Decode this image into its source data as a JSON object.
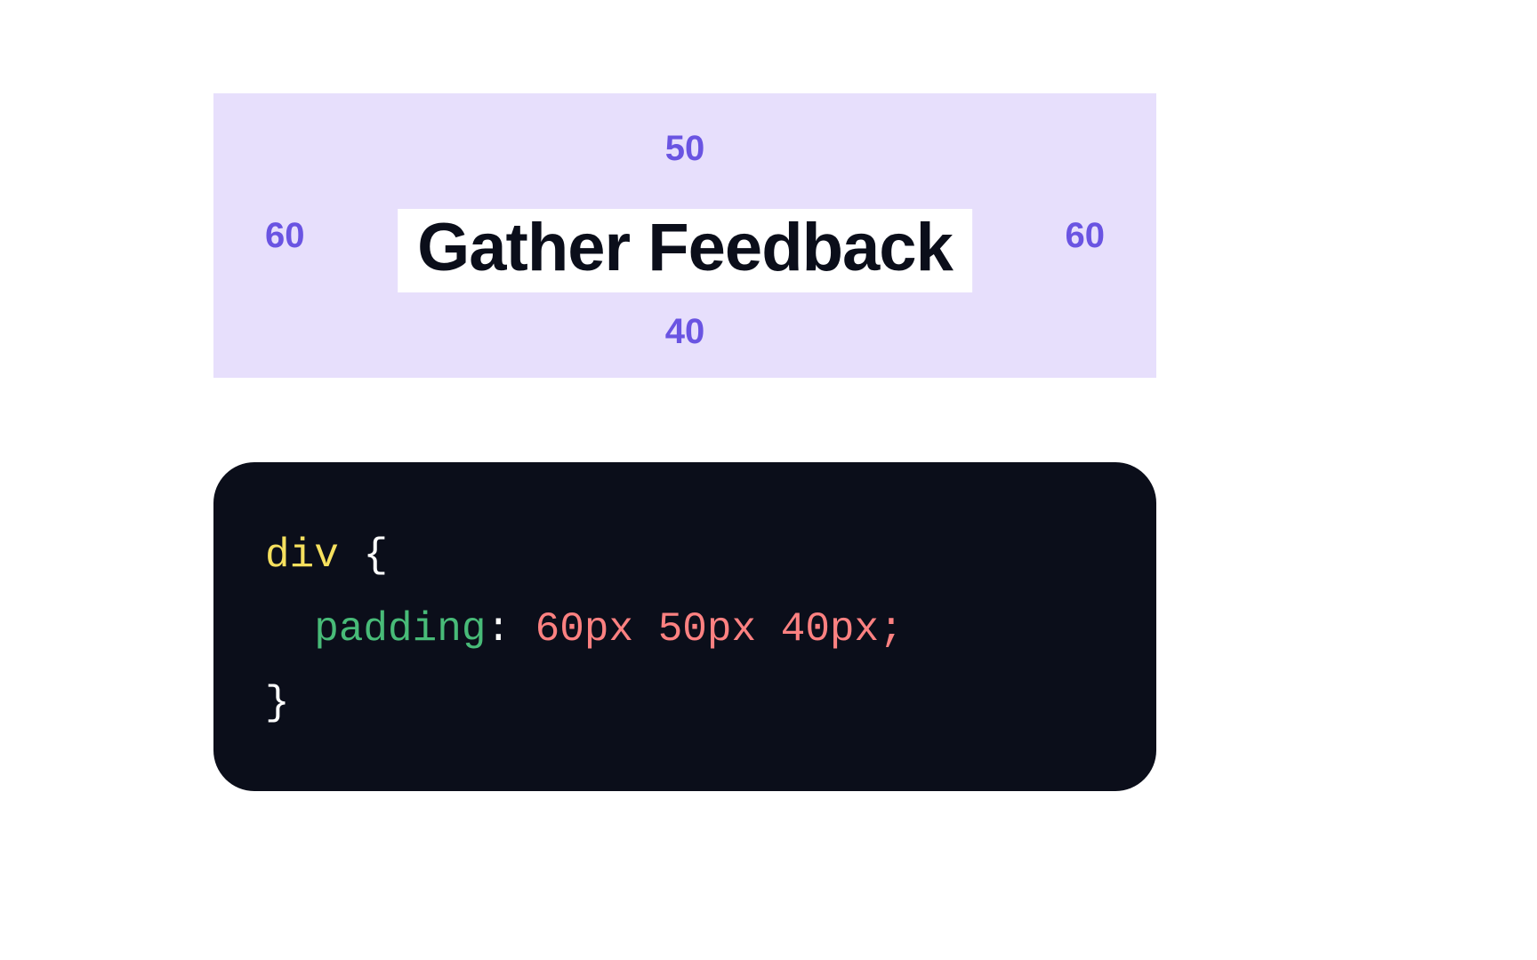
{
  "diagram": {
    "content_text": "Gather Feedback",
    "padding": {
      "top": "50",
      "right": "60",
      "bottom": "40",
      "left": "60"
    }
  },
  "code": {
    "selector": "div",
    "brace_open": "{",
    "brace_close": "}",
    "indent": "  ",
    "property": "padding",
    "colon": ":",
    "value": " 60px 50px 40px;"
  }
}
